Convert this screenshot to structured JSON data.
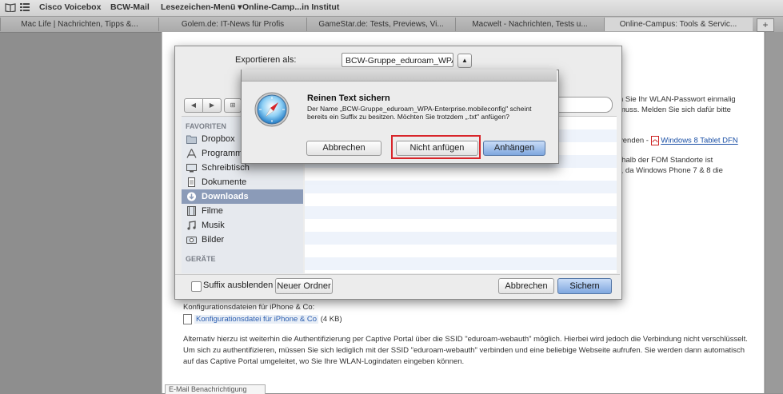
{
  "bookmarks_bar": {
    "items": [
      "Cisco Voicebox",
      "BCW-Mail",
      "Lesezeichen-Menü ▾",
      "Online-Camp...in Institut"
    ]
  },
  "tabs": [
    {
      "label": "Mac Life | Nachrichten, Tipps &..."
    },
    {
      "label": "Golem.de: IT-News für Profis"
    },
    {
      "label": "GameStar.de: Tests, Previews, Vi..."
    },
    {
      "label": "Macwelt - Nachrichten, Tests u..."
    },
    {
      "label": "Online-Campus: Tools & Servic..."
    }
  ],
  "tab_plus": "+",
  "page": {
    "text_right_1": "n Sie Ihr WLAN-Passwort einmalig",
    "text_right_2": "muss. Melden Sie sich dafür bitte",
    "text_right_3": "venden - ",
    "win8_link": "Windows 8 Tablet DFN",
    "text_right_4": "rhalb der FOM Standorte ist",
    "text_right_5": "t, da Windows Phone 7 & 8 die",
    "config_heading": "Konfigurationsdateien für iPhone & Co:",
    "config_link": "Konfigurationsdatei für iPhone & Co",
    "config_size": "(4 KB)",
    "para1": "Alternativ hierzu ist weiterhin die Authentifizierung per Captive Portal über die SSID \"eduroam-webauth\" möglich. Hierbei wird jedoch die Verbindung nicht verschlüsselt.",
    "para2": "Um sich zu authentifizieren, müssen Sie sich lediglich mit der SSID \"eduroam-webauth\" verbinden und eine beliebige Webseite aufrufen. Sie werden dann automatisch",
    "para3": "auf das Captive Portal umgeleitet, wo Sie Ihre WLAN-Logindaten eingeben können.",
    "email_box": "E-Mail Benachrichtigung"
  },
  "save_sheet": {
    "export_label": "Exportieren als:",
    "export_value": "BCW-Gruppe_eduroam_WPA-Ente",
    "sidebar": {
      "favorites_heading": "FAVORITEN",
      "items": [
        {
          "label": "Dropbox",
          "icon": "folder-icon"
        },
        {
          "label": "Programme",
          "icon": "applications-icon"
        },
        {
          "label": "Schreibtisch",
          "icon": "desktop-icon"
        },
        {
          "label": "Dokumente",
          "icon": "documents-icon"
        },
        {
          "label": "Downloads",
          "icon": "downloads-icon"
        },
        {
          "label": "Filme",
          "icon": "movies-icon"
        },
        {
          "label": "Musik",
          "icon": "music-icon"
        },
        {
          "label": "Bilder",
          "icon": "pictures-icon"
        }
      ],
      "devices_heading": "GERÄTE"
    },
    "suffix_label": "Suffix ausblenden",
    "new_folder": "Neuer Ordner",
    "cancel": "Abbrechen",
    "save": "Sichern"
  },
  "alert": {
    "title": "Reinen Text sichern",
    "message": "Der Name „BCW-Gruppe_eduroam_WPA-Enterprise.mobileconfig\" scheint bereits ein Suffix zu besitzen. Möchten Sie trotzdem „.txt\" anfügen?",
    "cancel": "Abbrechen",
    "dont_append": "Nicht anfügen",
    "append": "Anhängen",
    "highlight_color": "#d8252a"
  }
}
